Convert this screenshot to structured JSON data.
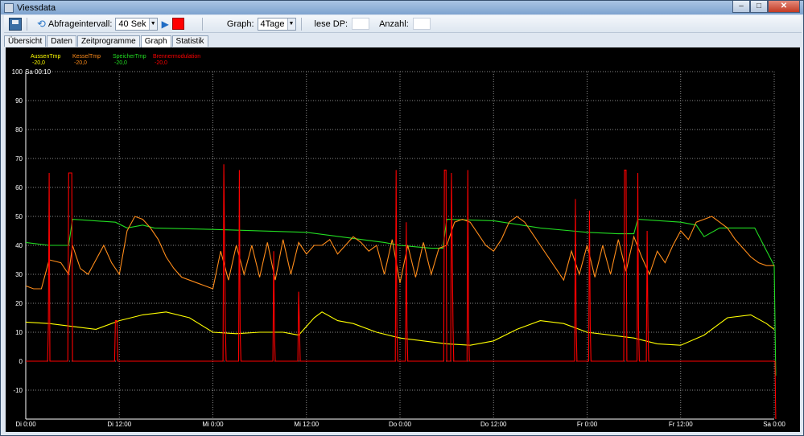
{
  "window": {
    "title": "Viessdata",
    "minimize": "–",
    "maximize": "□",
    "close": "✕"
  },
  "toolbar": {
    "interval_label": "Abfrageintervall:",
    "interval_value": "40 Sek",
    "graph_label": "Graph:",
    "graph_value": "4Tage",
    "read_dp_label": "lese DP:",
    "read_dp_value": "",
    "count_label": "Anzahl:",
    "count_value": ""
  },
  "tabs": [
    "Übersicht",
    "Daten",
    "Zeitprogramme",
    "Graph",
    "Statistik"
  ],
  "active_tab": 3,
  "colors": {
    "aussen": "#ffff00",
    "kessel": "#ff8c1a",
    "speicher": "#22dd22",
    "brenner": "#ff0000",
    "axis": "#ffffff",
    "grid": "#8a8a8a"
  },
  "chart_data": {
    "type": "line",
    "cursor_label": "Sa 00:10",
    "legend": [
      {
        "name": "AussenTmp",
        "value": "-20,0",
        "color": "#ffff00"
      },
      {
        "name": "KesselTmp",
        "value": "-20,0",
        "color": "#ff8c1a"
      },
      {
        "name": "SpeicherTmp",
        "value": "-20,0",
        "color": "#22dd22"
      },
      {
        "name": "Brennermodulation",
        "value": "-20,0",
        "color": "#ff0000"
      }
    ],
    "ylim": [
      -20,
      100
    ],
    "yticks": [
      "100",
      "90",
      "80",
      "70",
      "60",
      "50",
      "40",
      "30",
      "20",
      "10",
      "0",
      "-10"
    ],
    "xlim": [
      0,
      96
    ],
    "xticks": [
      {
        "h": 0,
        "label": "Di 0:00"
      },
      {
        "h": 12,
        "label": "Di 12:00"
      },
      {
        "h": 24,
        "label": "Mi 0:00"
      },
      {
        "h": 36,
        "label": "Mi 12:00"
      },
      {
        "h": 48,
        "label": "Do 0:00"
      },
      {
        "h": 60,
        "label": "Do 12:00"
      },
      {
        "h": 72,
        "label": "Fr 0:00"
      },
      {
        "h": 84,
        "label": "Fr 12:00"
      },
      {
        "h": 96,
        "label": "Sa 0:00"
      }
    ],
    "series": [
      {
        "name": "SpeicherTmp",
        "color": "#22dd22",
        "x": [
          0,
          3,
          5.5,
          6,
          11.5,
          13,
          15,
          16.5,
          24,
          36,
          46,
          48,
          52,
          53.5,
          54,
          60,
          66,
          70,
          72,
          76,
          78,
          78.5,
          84,
          86,
          87,
          89,
          93,
          93.5,
          96,
          96.2
        ],
        "y": [
          41,
          40,
          40,
          49,
          48,
          46,
          47,
          46,
          45.5,
          44.5,
          41,
          40,
          39,
          39,
          49,
          48.5,
          46,
          45,
          44.5,
          44,
          44,
          49,
          48,
          47,
          43,
          46,
          46,
          46,
          33,
          -5
        ]
      },
      {
        "name": "KesselTmp",
        "color": "#ff8c1a",
        "x": [
          0,
          1,
          2,
          3,
          4.5,
          5.5,
          6,
          7,
          8,
          9,
          10,
          11,
          12,
          13,
          14,
          15,
          16,
          17,
          18,
          19,
          20,
          21,
          22,
          23,
          24,
          25,
          26,
          27,
          28,
          29,
          30,
          31,
          32,
          33,
          34,
          35,
          36,
          37,
          38,
          39,
          40,
          41,
          42,
          43,
          44,
          45,
          46,
          47,
          48,
          49,
          50,
          51,
          52,
          53,
          54,
          55,
          56,
          57,
          58,
          59,
          60,
          61,
          62,
          63,
          64,
          65,
          66,
          67,
          68,
          69,
          70,
          71,
          72,
          73,
          74,
          75,
          76,
          77,
          78,
          79,
          80,
          81,
          82,
          83,
          84,
          85,
          86,
          87,
          88,
          89,
          90,
          91,
          92,
          93,
          94,
          95,
          96
        ],
        "y": [
          26,
          25,
          25,
          35,
          34,
          30,
          40,
          32,
          30,
          35,
          40,
          34,
          30,
          45,
          50,
          49,
          46,
          42,
          36,
          32,
          29,
          28,
          27,
          26,
          25,
          38,
          28,
          40,
          30,
          40,
          29,
          41,
          28,
          42,
          30,
          41,
          37,
          40,
          40,
          42,
          37,
          40,
          43,
          41,
          38,
          40,
          30,
          42,
          27,
          40,
          29,
          41,
          30,
          39,
          40,
          48,
          49,
          48,
          44,
          40,
          38,
          42,
          48,
          50,
          48,
          44,
          40,
          36,
          32,
          28,
          38,
          30,
          40,
          29,
          40,
          30,
          42,
          31,
          43,
          36,
          30,
          38,
          34,
          40,
          45,
          42,
          48,
          49,
          50,
          48,
          46,
          42,
          39,
          36,
          34,
          33,
          33
        ]
      },
      {
        "name": "AussenTmp",
        "color": "#ffff00",
        "x": [
          0,
          3,
          6,
          9,
          12,
          15,
          18,
          21,
          24,
          27,
          30,
          33,
          35,
          36,
          37,
          38,
          40,
          42,
          45,
          48,
          51,
          54,
          57,
          60,
          63,
          66,
          69,
          72,
          75,
          78,
          81,
          84,
          87,
          90,
          93,
          95,
          96
        ],
        "y": [
          13.5,
          13,
          12,
          11,
          14,
          16,
          17,
          15,
          10,
          9.5,
          10,
          10,
          9,
          12,
          15,
          17,
          14,
          13,
          10,
          8,
          7,
          6,
          5.5,
          7,
          11,
          14,
          13,
          10,
          9,
          8,
          6,
          5.5,
          9,
          15,
          16,
          13,
          11
        ]
      },
      {
        "name": "Brennermodulation",
        "color": "#ff0000",
        "x": [
          0,
          2.8,
          2.9,
          3.0,
          3.1,
          5.4,
          5.5,
          5.6,
          5.9,
          6.0,
          11.4,
          11.5,
          11.7,
          11.8,
          25.3,
          25.4,
          25.6,
          25.7,
          27.3,
          27.4,
          27.5,
          27.6,
          31.7,
          31.8,
          31.9,
          32.0,
          34.9,
          35.0,
          35.1,
          35.2,
          47.4,
          47.5,
          47.6,
          47.7,
          48.7,
          48.8,
          48.9,
          49.0,
          53.6,
          53.7,
          53.9,
          54.0,
          54.5,
          54.6,
          54.8,
          54.9,
          56.6,
          56.7,
          56.8,
          56.9,
          70.4,
          70.5,
          70.6,
          70.7,
          72.2,
          72.3,
          72.4,
          72.5,
          76.7,
          76.8,
          77.0,
          77.1,
          78.4,
          78.5,
          78.6,
          78.7,
          79.6,
          79.7,
          79.8,
          79.9,
          96.0,
          96.1,
          96.2
        ],
        "y": [
          0,
          0,
          12,
          65,
          0,
          0,
          65,
          65,
          65,
          0,
          0,
          14,
          14,
          0,
          0,
          68,
          12,
          0,
          0,
          66,
          10,
          0,
          0,
          38,
          10,
          0,
          0,
          24,
          13,
          0,
          0,
          66,
          12,
          0,
          0,
          48,
          12,
          0,
          0,
          66,
          66,
          0,
          0,
          65,
          12,
          0,
          0,
          66,
          12,
          0,
          0,
          56,
          12,
          0,
          0,
          52,
          12,
          0,
          0,
          66,
          66,
          0,
          0,
          65,
          12,
          0,
          0,
          45,
          12,
          0,
          0,
          0,
          -20
        ]
      }
    ]
  }
}
